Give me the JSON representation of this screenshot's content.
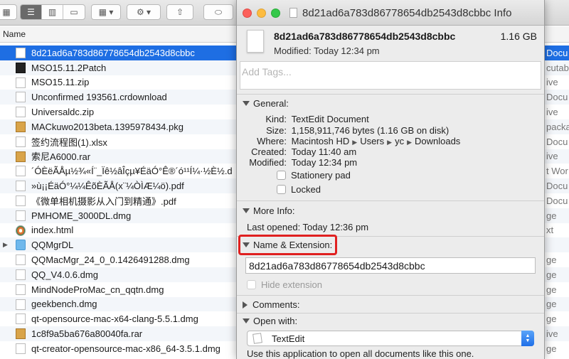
{
  "finder": {
    "column_header": "Name",
    "files": [
      {
        "name": "8d21ad6a783d86778654db2543d8cbbc",
        "icon": "document-icon",
        "kind": "Docu",
        "selected": true
      },
      {
        "name": "MSO15.11.2Patch",
        "icon": "executable-icon",
        "kind": "cutab"
      },
      {
        "name": "MSO15.11.zip",
        "icon": "zip-icon",
        "kind": "ive"
      },
      {
        "name": "Unconfirmed 193561.crdownload",
        "icon": "document-icon",
        "kind": "Docu"
      },
      {
        "name": "Universaldc.zip",
        "icon": "zip-icon",
        "kind": "ive"
      },
      {
        "name": "MACkuwo2013beta.1395978434.pkg",
        "icon": "package-icon",
        "kind": "packa"
      },
      {
        "name": "签约流程图(1).xlsx",
        "icon": "document-icon",
        "kind": "Docu"
      },
      {
        "name": "索尼A6000.rar",
        "icon": "package-icon",
        "kind": "ive"
      },
      {
        "name": "´ÓÈëÃÅµ½¾«Í¨_Ïê½âÎçµ¥ÉäÓ°Ê®´ó¹¹Í¼·½È½.d",
        "icon": "document-icon",
        "kind": "t Wor"
      },
      {
        "name": "»ù¡¡ÉäÓ°¼¼ÊõÈÃÅ(x¨¼ÒÌÆ¼ö).pdf",
        "icon": "document-icon",
        "kind": "Docu"
      },
      {
        "name": "《微单相机摄影从入门到精通》.pdf",
        "icon": "document-icon",
        "kind": "Docu"
      },
      {
        "name": "PMHOME_3000DL.dmg",
        "icon": "disk-image-icon",
        "kind": "ge"
      },
      {
        "name": "index.html",
        "icon": "html-icon",
        "kind": "xt"
      },
      {
        "name": "QQMgrDL",
        "icon": "folder-icon",
        "kind": "",
        "expandable": true
      },
      {
        "name": "QQMacMgr_24_0_0.1426491288.dmg",
        "icon": "disk-image-icon",
        "kind": "ge"
      },
      {
        "name": "QQ_V4.0.6.dmg",
        "icon": "disk-image-icon",
        "kind": "ge"
      },
      {
        "name": "MindNodeProMac_cn_qqtn.dmg",
        "icon": "disk-image-icon",
        "kind": "ge"
      },
      {
        "name": "geekbench.dmg",
        "icon": "disk-image-icon",
        "kind": "ge"
      },
      {
        "name": "qt-opensource-mac-x64-clang-5.5.1.dmg",
        "icon": "disk-image-icon",
        "kind": "ge"
      },
      {
        "name": "1c8f9a5ba676a80040fa.rar",
        "icon": "package-icon",
        "kind": "ive"
      },
      {
        "name": "qt-creator-opensource-mac-x86_64-3.5.1.dmg",
        "icon": "disk-image-icon",
        "kind": "ge"
      }
    ]
  },
  "info": {
    "window_title": "8d21ad6a783d86778654db2543d8cbbc Info",
    "file_name": "8d21ad6a783d86778654db2543d8cbbc",
    "file_size": "1.16 GB",
    "modified_summary": "Modified: Today 12:34 pm",
    "tags_placeholder": "Add Tags...",
    "general": {
      "title": "General:",
      "kind_label": "Kind:",
      "kind": "TextEdit Document",
      "size_label": "Size:",
      "size": "1,158,911,746 bytes (1.16 GB on disk)",
      "where_label": "Where:",
      "where": [
        "Macintosh HD",
        "Users",
        "yc",
        "Downloads"
      ],
      "created_label": "Created:",
      "created": "Today 11:40 am",
      "modified_label": "Modified:",
      "modified": "Today 12:34 pm",
      "stationery": "Stationery pad",
      "locked": "Locked"
    },
    "more_info": {
      "title": "More Info:",
      "last_opened": "Last opened: Today 12:36 pm"
    },
    "name_ext": {
      "title": "Name & Extension:",
      "value": "8d21ad6a783d86778654db2543d8cbbc",
      "hide_extension": "Hide extension"
    },
    "comments": {
      "title": "Comments:"
    },
    "open_with": {
      "title": "Open with:",
      "app": "TextEdit",
      "note": "Use this application to open all documents like this one."
    }
  },
  "colors": {
    "selection": "#1e6ee3",
    "highlight": "#e02020",
    "select_arrow": "#1f6fe8"
  }
}
